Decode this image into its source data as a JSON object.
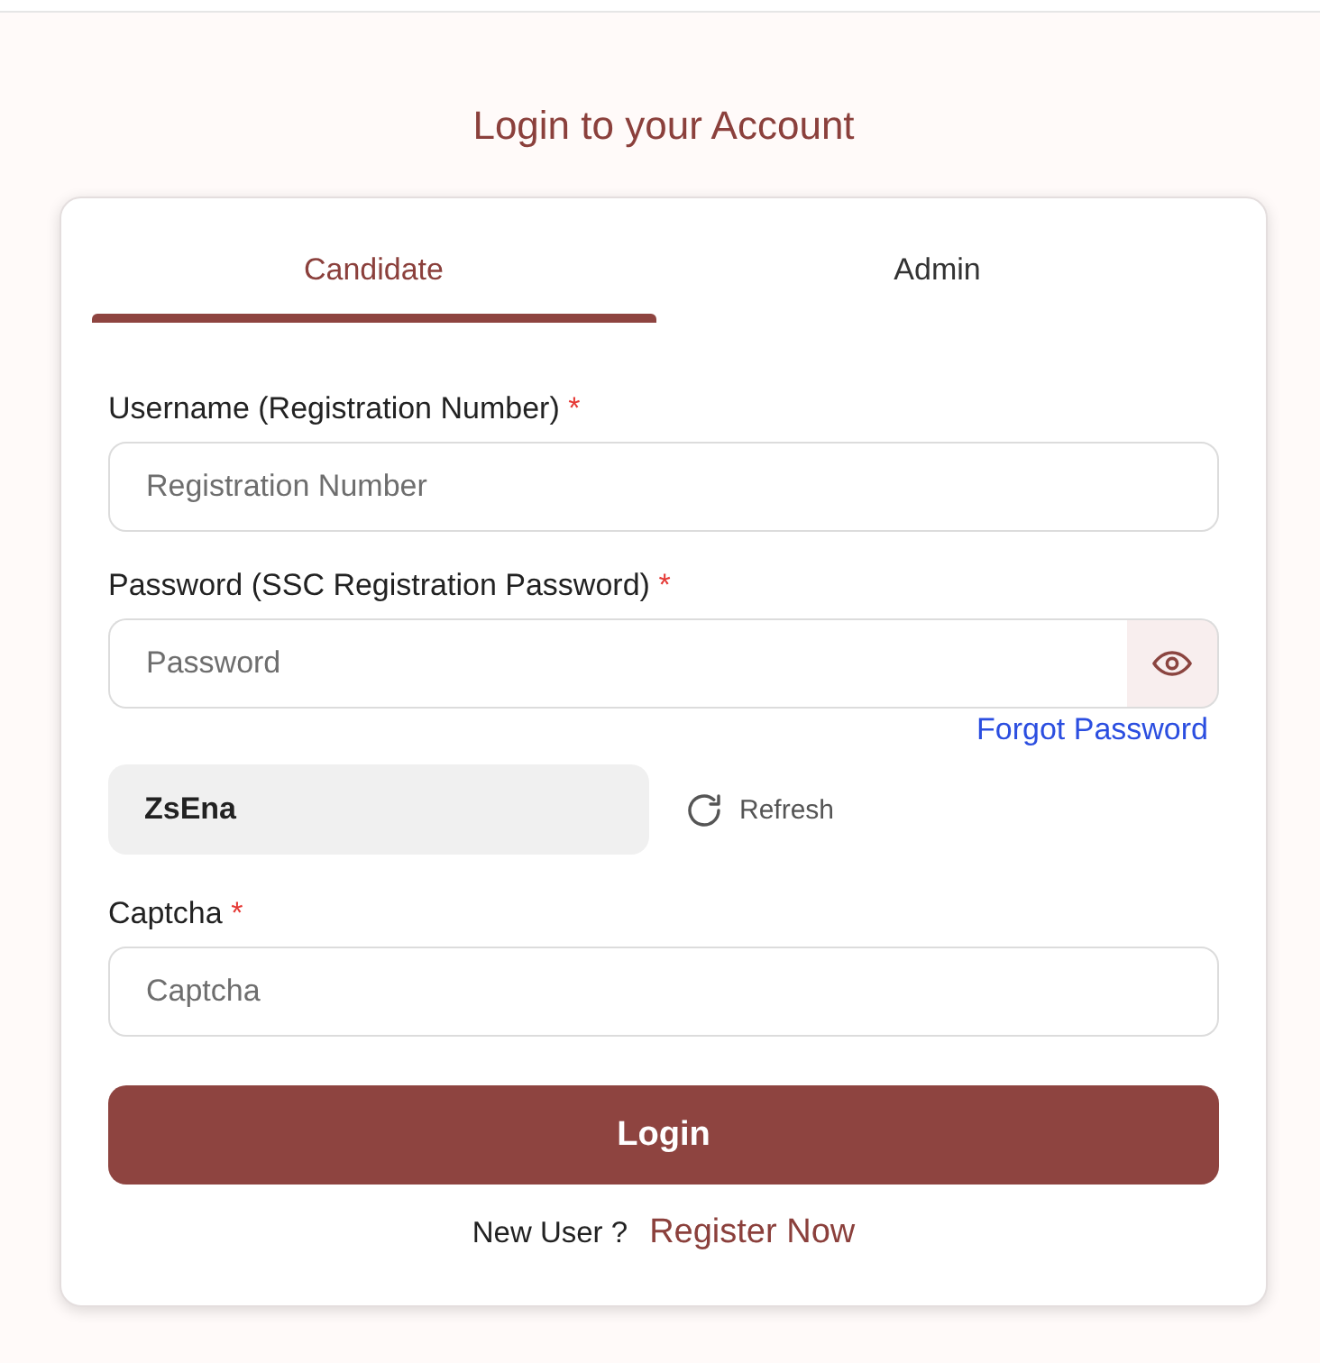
{
  "title": "Login to your Account",
  "tabs": [
    {
      "label": "Candidate",
      "selected": true
    },
    {
      "label": "Admin",
      "selected": false
    }
  ],
  "fields": [
    {
      "kind": "text",
      "label": "Username (Registration Number)",
      "required_mark": "*",
      "placeholder": "Registration Number"
    },
    {
      "kind": "password",
      "label": "Password (SSC Registration Password)",
      "required_mark": "*",
      "placeholder": "Password",
      "link": "Forgot Password"
    },
    {
      "kind": "captcha_code",
      "code": "ZsEna",
      "refresh": "Refresh"
    },
    {
      "kind": "text",
      "label": "Captcha",
      "required_mark": "*",
      "placeholder": "Captcha"
    }
  ],
  "login_button": "Login",
  "register": {
    "prompt": "New User ?",
    "link": "Register Now"
  }
}
